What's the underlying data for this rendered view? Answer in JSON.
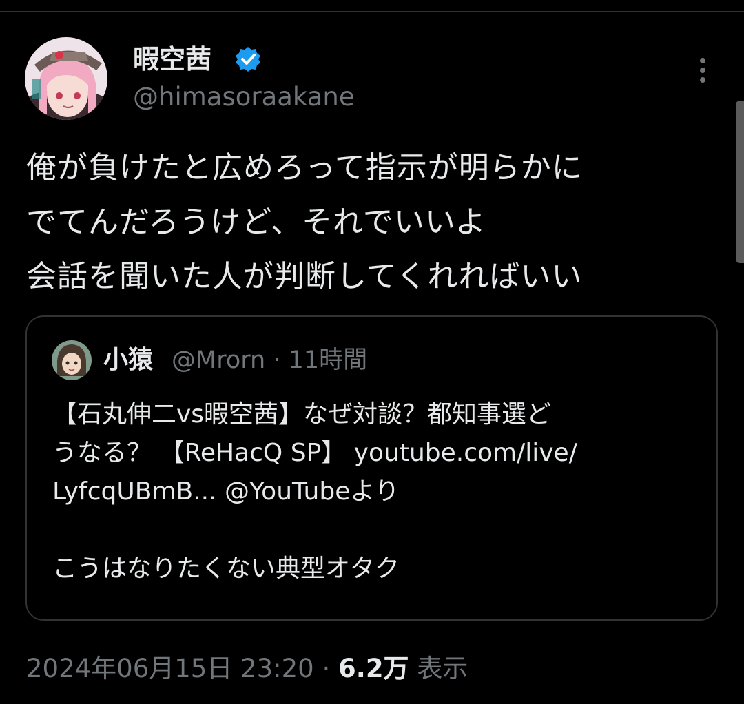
{
  "author": {
    "display_name": "暇空茜",
    "handle": "@himasoraakane"
  },
  "tweet": {
    "lines": [
      "俺が負けたと広めろって指示が明らかに",
      "でてんだろうけど、それでいいよ",
      "会話を聞いた人が判断してくれればいい"
    ]
  },
  "quoted": {
    "display_name": "小猿",
    "handle": "@Mrorn",
    "separator": "·",
    "time": "11時間",
    "lines": [
      "【石丸伸二vs暇空茜】なぜ対談？都知事選ど",
      "うなる？ 【ReHacQ SP】 youtube.com/live/",
      "LyfcqUBmB... @YouTubeより",
      "",
      "こうはなりたくない典型オタク"
    ]
  },
  "footer": {
    "timestamp": "2024年06月15日 23:20",
    "separator": "·",
    "views": "6.2万",
    "views_label": "表示"
  },
  "icons": [
    "verified-badge-icon",
    "more-options-icon"
  ],
  "colors": {
    "background": "#000000",
    "text": "#e7e9ea",
    "secondary": "#71767b",
    "verified": "#1d9bf0",
    "border": "#2f3336"
  }
}
